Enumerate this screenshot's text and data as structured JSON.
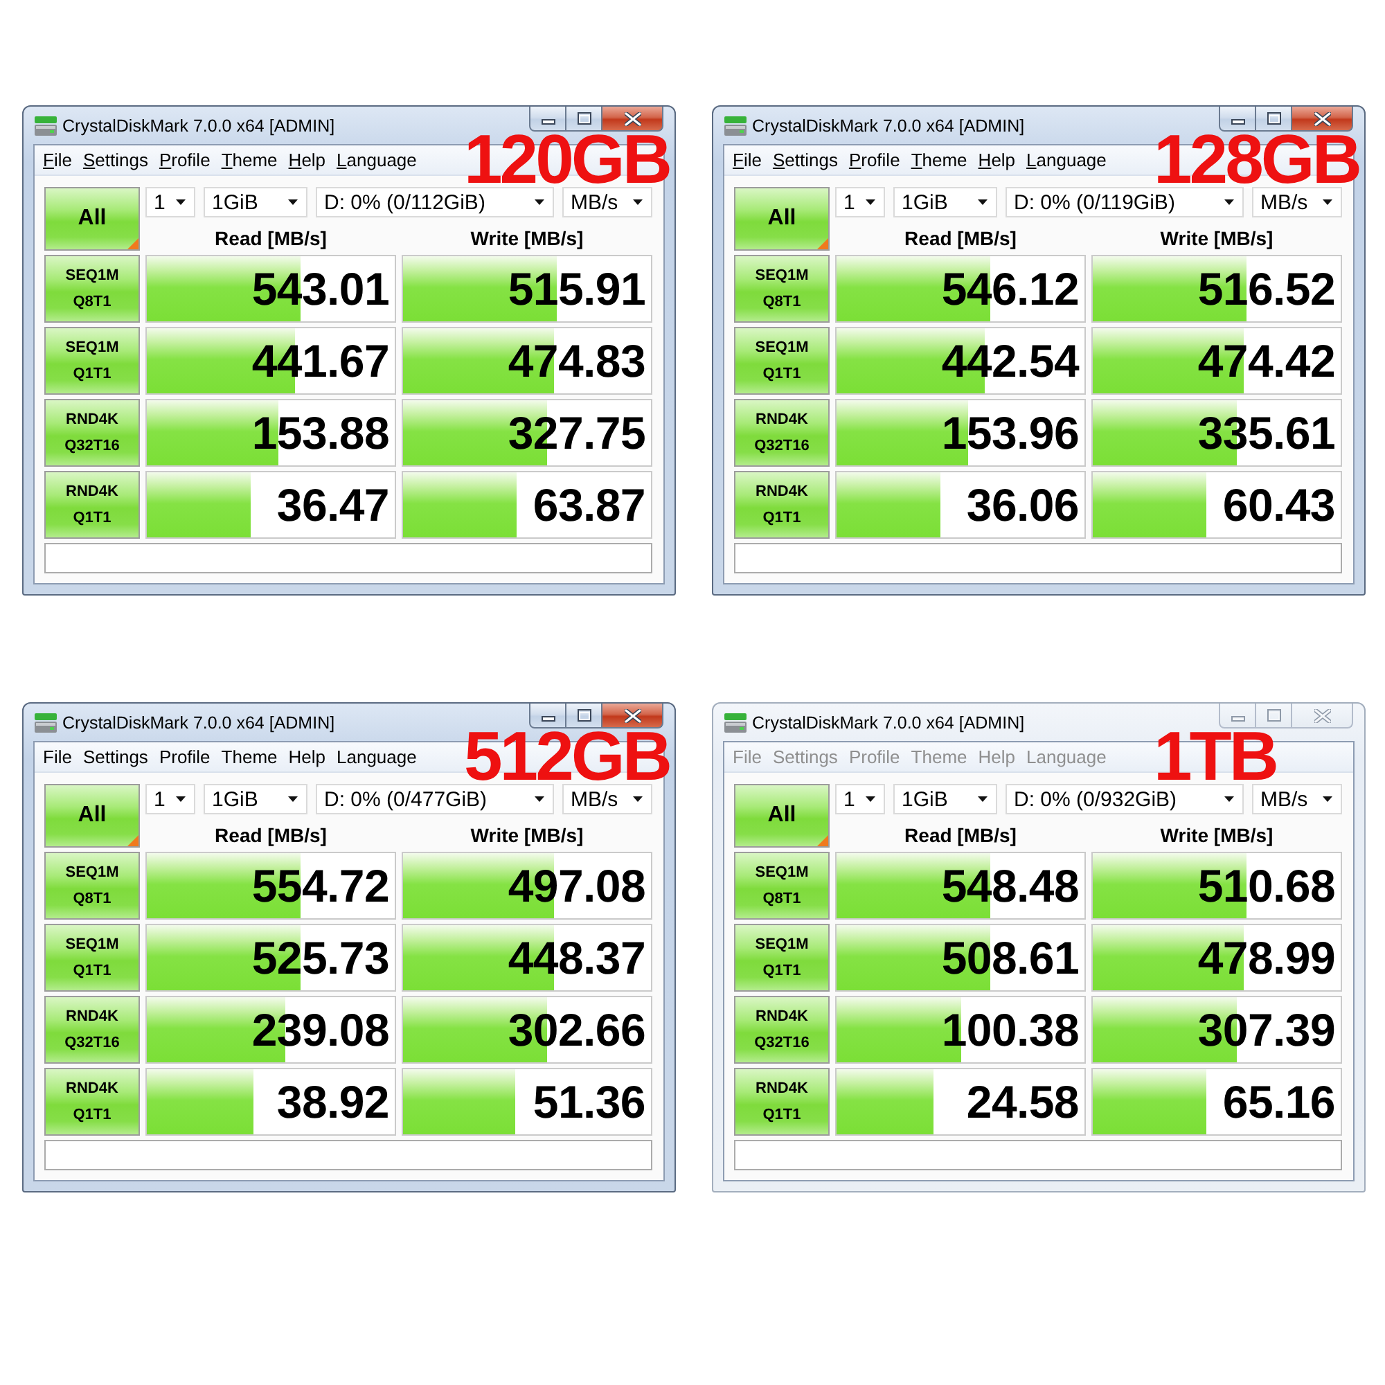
{
  "windows": [
    {
      "title": "CrystalDiskMark 7.0.0 x64 [ADMIN]",
      "active": true,
      "menu_access_keys": true,
      "menu": [
        "File",
        "Settings",
        "Profile",
        "Theme",
        "Help",
        "Language"
      ],
      "capacity_label": "120GB",
      "all_button": "All",
      "count": "1",
      "size": "1GiB",
      "drive": "D: 0% (0/112GiB)",
      "unit": "MB/s",
      "columns": [
        "Read [MB/s]",
        "Write [MB/s]"
      ],
      "rows": [
        {
          "test": "SEQ1M",
          "params": "Q8T1",
          "read": {
            "value": "543.01",
            "level": 0.62
          },
          "write": {
            "value": "515.91",
            "level": 0.62
          }
        },
        {
          "test": "SEQ1M",
          "params": "Q1T1",
          "read": {
            "value": "441.67",
            "level": 0.6
          },
          "write": {
            "value": "474.83",
            "level": 0.61
          }
        },
        {
          "test": "RND4K",
          "params": "Q32T16",
          "read": {
            "value": "153.88",
            "level": 0.53
          },
          "write": {
            "value": "327.75",
            "level": 0.58
          }
        },
        {
          "test": "RND4K",
          "params": "Q1T1",
          "read": {
            "value": "36.47",
            "level": 0.42
          },
          "write": {
            "value": "63.87",
            "level": 0.46
          }
        }
      ]
    },
    {
      "title": "CrystalDiskMark 7.0.0 x64 [ADMIN]",
      "active": true,
      "menu_access_keys": true,
      "menu": [
        "File",
        "Settings",
        "Profile",
        "Theme",
        "Help",
        "Language"
      ],
      "capacity_label": "128GB",
      "all_button": "All",
      "count": "1",
      "size": "1GiB",
      "drive": "D: 0% (0/119GiB)",
      "unit": "MB/s",
      "columns": [
        "Read [MB/s]",
        "Write [MB/s]"
      ],
      "rows": [
        {
          "test": "SEQ1M",
          "params": "Q8T1",
          "read": {
            "value": "546.12",
            "level": 0.62
          },
          "write": {
            "value": "516.52",
            "level": 0.62
          }
        },
        {
          "test": "SEQ1M",
          "params": "Q1T1",
          "read": {
            "value": "442.54",
            "level": 0.6
          },
          "write": {
            "value": "474.42",
            "level": 0.61
          }
        },
        {
          "test": "RND4K",
          "params": "Q32T16",
          "read": {
            "value": "153.96",
            "level": 0.53
          },
          "write": {
            "value": "335.61",
            "level": 0.58
          }
        },
        {
          "test": "RND4K",
          "params": "Q1T1",
          "read": {
            "value": "36.06",
            "level": 0.42
          },
          "write": {
            "value": "60.43",
            "level": 0.46
          }
        }
      ]
    },
    {
      "title": "CrystalDiskMark 7.0.0 x64 [ADMIN]",
      "active": true,
      "menu_access_keys": false,
      "menu": [
        "File",
        "Settings",
        "Profile",
        "Theme",
        "Help",
        "Language"
      ],
      "capacity_label": "512GB",
      "all_button": "All",
      "count": "1",
      "size": "1GiB",
      "drive": "D: 0% (0/477GiB)",
      "unit": "MB/s",
      "columns": [
        "Read [MB/s]",
        "Write [MB/s]"
      ],
      "rows": [
        {
          "test": "SEQ1M",
          "params": "Q8T1",
          "read": {
            "value": "554.72",
            "level": 0.62
          },
          "write": {
            "value": "497.08",
            "level": 0.61
          }
        },
        {
          "test": "SEQ1M",
          "params": "Q1T1",
          "read": {
            "value": "525.73",
            "level": 0.62
          },
          "write": {
            "value": "448.37",
            "level": 0.61
          }
        },
        {
          "test": "RND4K",
          "params": "Q32T16",
          "read": {
            "value": "239.08",
            "level": 0.56
          },
          "write": {
            "value": "302.66",
            "level": 0.58
          }
        },
        {
          "test": "RND4K",
          "params": "Q1T1",
          "read": {
            "value": "38.92",
            "level": 0.43
          },
          "write": {
            "value": "51.36",
            "level": 0.45
          }
        }
      ]
    },
    {
      "title": "CrystalDiskMark 7.0.0 x64 [ADMIN]",
      "active": false,
      "menu_access_keys": false,
      "menu": [
        "File",
        "Settings",
        "Profile",
        "Theme",
        "Help",
        "Language"
      ],
      "capacity_label": "1TB",
      "all_button": "All",
      "count": "1",
      "size": "1GiB",
      "drive": "D: 0% (0/932GiB)",
      "unit": "MB/s",
      "columns": [
        "Read [MB/s]",
        "Write [MB/s]"
      ],
      "rows": [
        {
          "test": "SEQ1M",
          "params": "Q8T1",
          "read": {
            "value": "548.48",
            "level": 0.62
          },
          "write": {
            "value": "510.68",
            "level": 0.62
          }
        },
        {
          "test": "SEQ1M",
          "params": "Q1T1",
          "read": {
            "value": "508.61",
            "level": 0.62
          },
          "write": {
            "value": "478.99",
            "level": 0.61
          }
        },
        {
          "test": "RND4K",
          "params": "Q32T16",
          "read": {
            "value": "100.38",
            "level": 0.5
          },
          "write": {
            "value": "307.39",
            "level": 0.58
          }
        },
        {
          "test": "RND4K",
          "params": "Q1T1",
          "read": {
            "value": "24.58",
            "level": 0.39
          },
          "write": {
            "value": "65.16",
            "level": 0.46
          }
        }
      ]
    }
  ]
}
